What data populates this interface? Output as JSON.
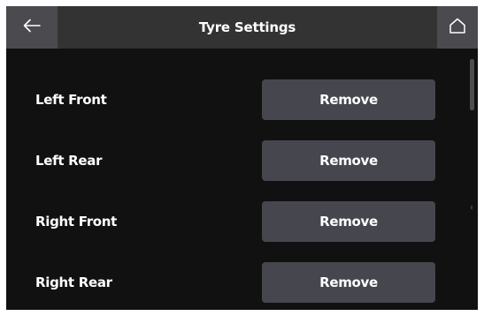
{
  "header": {
    "title": "Tyre Settings",
    "back_icon": "arrow-left-icon",
    "home_icon": "home-icon"
  },
  "settings": {
    "rows": [
      {
        "label": "Left Front",
        "button_label": "Remove"
      },
      {
        "label": "Left Rear",
        "button_label": "Remove"
      },
      {
        "label": "Right Front",
        "button_label": "Remove"
      },
      {
        "label": "Right Rear",
        "button_label": "Remove"
      }
    ]
  },
  "colors": {
    "background": "#111111",
    "header": "#333333",
    "header_button": "#4a4a4f",
    "button": "#46464e",
    "text": "#ffffff"
  }
}
